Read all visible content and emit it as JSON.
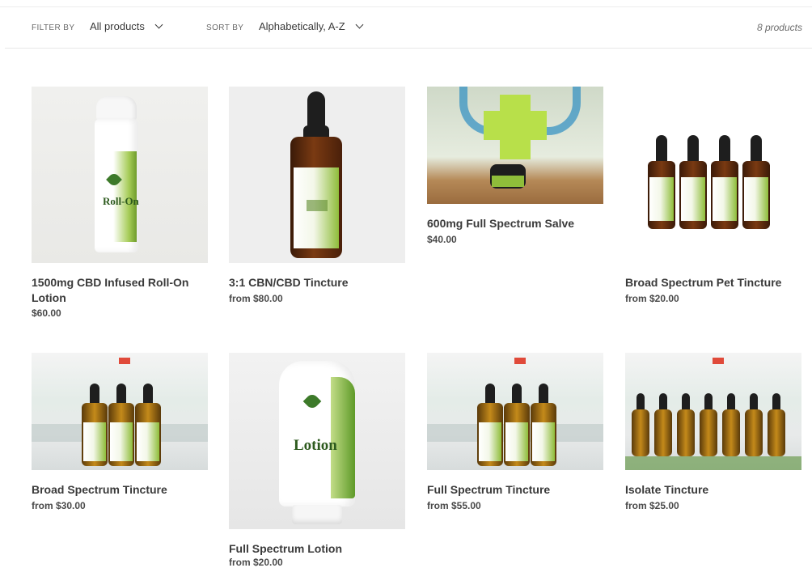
{
  "filter": {
    "label": "FILTER BY",
    "value": "All products"
  },
  "sort": {
    "label": "SORT BY",
    "value": "Alphabetically, A-Z"
  },
  "product_count": "8 products",
  "products": [
    {
      "title": "1500mg CBD Infused Roll-On Lotion",
      "price": "$60.00",
      "image": "roll-on-lotion-image"
    },
    {
      "title": "3:1 CBN/CBD Tincture",
      "price": "from $80.00",
      "image": "tincture-bottle-image"
    },
    {
      "title": "600mg Full Spectrum Salve",
      "price": "$40.00",
      "image": "salve-jar-image"
    },
    {
      "title": "Broad Spectrum Pet Tincture",
      "price": "from $20.00",
      "image": "pet-tincture-image"
    },
    {
      "title": "Broad Spectrum Tincture",
      "price": "from $30.00",
      "image": "tincture-trio-image"
    },
    {
      "title": "Full Spectrum Lotion",
      "price": "from $20.00",
      "image": "lotion-tube-image"
    },
    {
      "title": "Full Spectrum Tincture",
      "price": "from $55.00",
      "image": "tincture-trio-image"
    },
    {
      "title": "Isolate Tincture",
      "price": "from $25.00",
      "image": "tincture-lineup-image"
    }
  ],
  "colors": {
    "brand_green": "#8fbd3a",
    "text": "#3a3a3a"
  }
}
